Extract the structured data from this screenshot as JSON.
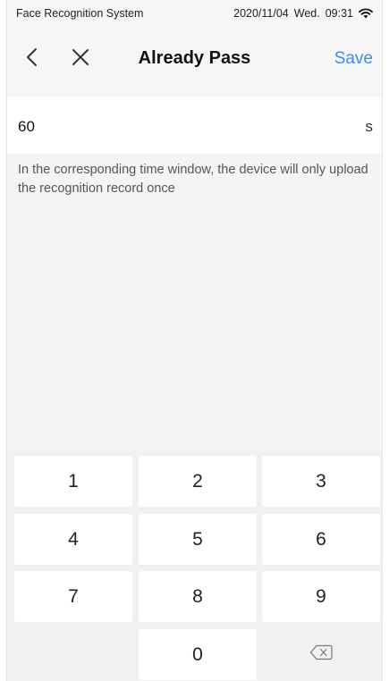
{
  "status_bar": {
    "app_name": "Face Recognition System",
    "date": "2020/11/04",
    "weekday": "Wed.",
    "time": "09:31",
    "wifi_icon": "wifi-icon"
  },
  "nav": {
    "title": "Already Pass",
    "save_label": "Save",
    "back_icon": "chevron-left-icon",
    "close_icon": "close-icon",
    "accent_color": "#3a8ef0"
  },
  "input": {
    "value": "60",
    "unit": "s"
  },
  "hint": "In the corresponding time window, the device will only upload the recognition record once",
  "keypad": {
    "keys": [
      "1",
      "2",
      "3",
      "4",
      "5",
      "6",
      "7",
      "8",
      "9",
      "0"
    ],
    "backspace_icon": "backspace-icon"
  }
}
